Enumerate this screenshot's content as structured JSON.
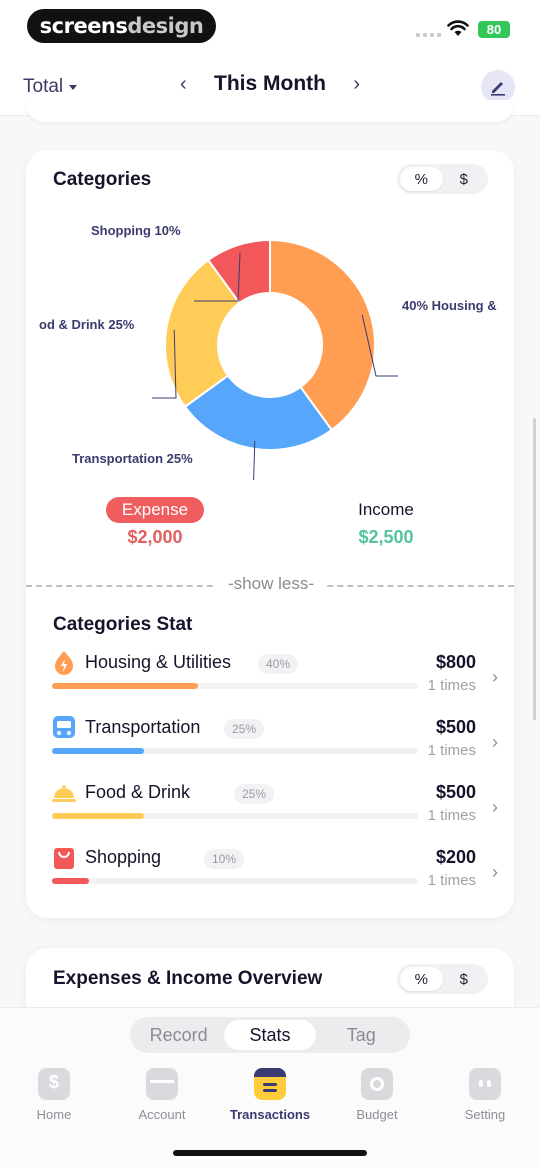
{
  "status": {
    "logo_main": "screens",
    "logo_light": "design",
    "battery": "80"
  },
  "nav": {
    "scope": "Total",
    "period": "This Month",
    "prev": "‹",
    "next": "›"
  },
  "categories_card": {
    "title": "Categories",
    "toggle": [
      "%",
      "$"
    ],
    "active_toggle": "%",
    "labels": [
      "Shopping 10%",
      "40% Housing &",
      "od & Drink 25%",
      "Transportation 25%"
    ],
    "expense_label": "Expense",
    "expense_value": "$2,000",
    "income_label": "Income",
    "income_value": "$2,500",
    "show_less": "-show less-"
  },
  "chart_data": {
    "type": "pie",
    "donut": true,
    "categories": [
      "Housing & Utilities",
      "Transportation",
      "Food & Drink",
      "Shopping"
    ],
    "values": [
      40,
      25,
      25,
      10
    ],
    "colors": [
      "#ff9d52",
      "#56a6fb",
      "#ffcd57",
      "#f2575a"
    ]
  },
  "stats": {
    "title": "Categories Stat",
    "rows": [
      {
        "name": "Housing & Utilities",
        "pct": "40%",
        "fraction": 0.4,
        "amount": "$800",
        "times": "1 times",
        "color": "#ff9d52",
        "icon": "flame-icon"
      },
      {
        "name": "Transportation",
        "pct": "25%",
        "fraction": 0.25,
        "amount": "$500",
        "times": "1 times",
        "color": "#56a6fb",
        "icon": "bus-icon"
      },
      {
        "name": "Food & Drink",
        "pct": "25%",
        "fraction": 0.25,
        "amount": "$500",
        "times": "1 times",
        "color": "#ffcd57",
        "icon": "cloche-icon"
      },
      {
        "name": "Shopping",
        "pct": "10%",
        "fraction": 0.1,
        "amount": "$200",
        "times": "1 times",
        "color": "#f2575a",
        "icon": "shopping-bag-icon"
      }
    ]
  },
  "overview_card": {
    "title": "Expenses & Income Overview",
    "toggle": [
      "%",
      "$"
    ]
  },
  "view_switch": {
    "options": [
      "Record",
      "Stats",
      "Tag"
    ],
    "active": "Stats"
  },
  "tabbar": {
    "items": [
      {
        "label": "Home",
        "icon": "dollar-icon"
      },
      {
        "label": "Account",
        "icon": "wallet-icon"
      },
      {
        "label": "Transactions",
        "icon": "calendar-list-icon"
      },
      {
        "label": "Budget",
        "icon": "budget-icon"
      },
      {
        "label": "Setting",
        "icon": "robot-icon"
      }
    ],
    "active": "Transactions"
  }
}
